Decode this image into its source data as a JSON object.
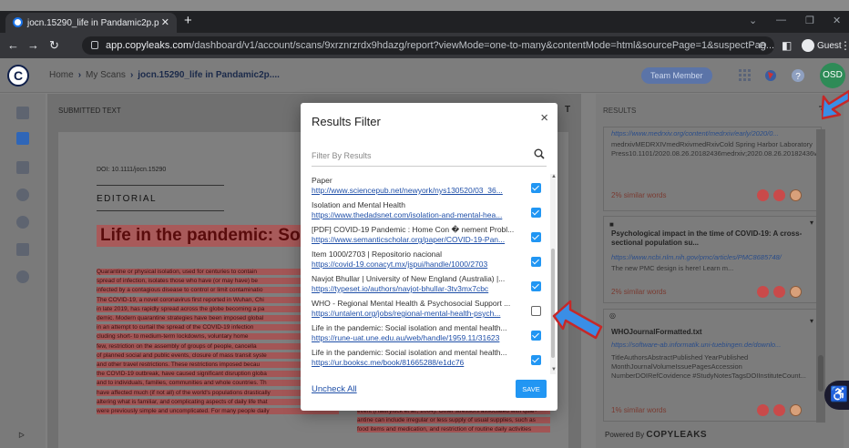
{
  "browser": {
    "tab_title": "jocn.15290_life in Pandamic2p.p",
    "new_tab": "+",
    "url_host": "app.copyleaks.com",
    "url_path": "/dashboard/v1/account/scans/9xrznrzrdx9hdazg/report?viewMode=one-to-many&contentMode=html&sourcePage=1&suspectPag...",
    "profile": "Guest"
  },
  "app": {
    "logo": "C",
    "breadcrumb": {
      "home": "Home",
      "scans": "My Scans",
      "current": "jocn.15290_life in Pandamic2p...."
    },
    "team_badge": "Team Member",
    "user_initials": "OSD"
  },
  "document": {
    "section_label": "SUBMITTED TEXT",
    "doi": "DOI: 10.1111/jocn.15290",
    "editorial": "EDITORIAL",
    "title": "Life in the pandemic: Social is",
    "paragraph_lines": [
      "Quarantine or physical isolation, used for centuries to contain",
      "spread of infection, isolates those who have (or may have) be",
      "infected by a contagious disease to control or limit contaminatio",
      "The COVID-19, a novel coronavirus first reported in Wuhan, Chi",
      "in late 2019, has rapidly spread across the globe becoming a pa",
      "demic. Modern quarantine strategies have been imposed global",
      "in an attempt to curtail the spread of the COVID-19 infection",
      "cluding short- to medium-term lockdowns, voluntary home",
      "few, restriction on the assembly of groups of people, cancella",
      "of planned social and public events, closure of mass transit syste",
      "and other travel restrictions. These restrictions imposed becau",
      "the COVID-19 outbreak, have caused significant disruption globa",
      "and to individuals, families, communities and whole countries. Th",
      "have affected much (if not all) of the world's populations drastically",
      "altering what is familiar, and complicating aspects of daily life that",
      "were previously simple and uncomplicated. For many people daily"
    ],
    "right_lines": [
      "event (Hawryluck et al., 2004). Other stressors associated with quar-",
      "antine can include irregular or less supply of usual supplies, such as",
      "food items and medication, and restriction of routine daily activities"
    ]
  },
  "results": {
    "label": "RESULTS",
    "card1": {
      "url": "https://www.medrxiv.org/content/medrxiv/early/2020/0...",
      "text": "medrxivMEDRXIVmedRxivmedRxivCold Spring Harbor Laboratory Press10.1101/2020.08.26.20182436medrxiv;2020.08.26.20182436v1medrxic2020.08.26...",
      "similar": "2% similar words"
    },
    "card2": {
      "title": "Psychological impact in the time of COVID-19: A cross-sectional population su...",
      "url": "https://www.ncbi.nlm.nih.gov/pmc/articles/PMC8685748/",
      "text": "The new PMC design is here! Learn m...",
      "similar": "2% similar words"
    },
    "card3": {
      "title": "WHOJournalFormatted.txt",
      "url": "https://software-ab.informatik.uni-tuebingen.de/downlo...",
      "text": "TitleAuthorsAbstractPublished YearPublished MonthJournalVolumeIssuePagesAccession NumberDOIRefCovidence #StudyNotesTagsDOIInstituteCount...",
      "similar": "1% similar words"
    },
    "powered_prefix": "Powered By",
    "powered_brand": "COPYLEAKS"
  },
  "modal": {
    "title": "Results Filter",
    "close": "×",
    "search_placeholder": "Filter By Results",
    "items": [
      {
        "title": "Paper",
        "url": "http://www.sciencepub.net/newyork/nys130520/03_36...",
        "checked": true
      },
      {
        "title": "Isolation and Mental Health",
        "url": "https://www.thedadsnet.com/isolation-and-mental-hea...",
        "checked": true
      },
      {
        "title": "[PDF] COVID-19 Pandemic : Home Con � nement Probl...",
        "url": "https://www.semanticscholar.org/paper/COVID-19-Pan...",
        "checked": true
      },
      {
        "title": "Item 1000/2703 | Repositorio nacional",
        "url": "https://covid-19.conacyt.mx/jspui/handle/1000/2703",
        "checked": true
      },
      {
        "title": "Navjot Bhullar | University of New England (Australia) |...",
        "url": "https://typeset.io/authors/navjot-bhullar-3tv3mx7cbc",
        "checked": true
      },
      {
        "title": "WHO - Regional Mental Health & Psychosocial Support ...",
        "url": "https://untalent.org/jobs/regional-mental-health-psych...",
        "checked": false
      },
      {
        "title": "Life in the pandemic: Social isolation and mental health...",
        "url": "https://rune-uat.une.edu.au/web/handle/1959.11/31623",
        "checked": true
      },
      {
        "title": "Life in the pandemic: Social isolation and mental health...",
        "url": "https://ur.booksc.me/book/81665288/e1dc76",
        "checked": true
      }
    ],
    "uncheck_all": "Uncheck All",
    "save": "SAVE"
  },
  "colors": {
    "checkbox_on": "#2196f3",
    "annotation_arrow": "#3a8ee6",
    "highlight": "#a35656",
    "dot_red": "#c94a4a",
    "dot_orange": "#d8a07a"
  }
}
